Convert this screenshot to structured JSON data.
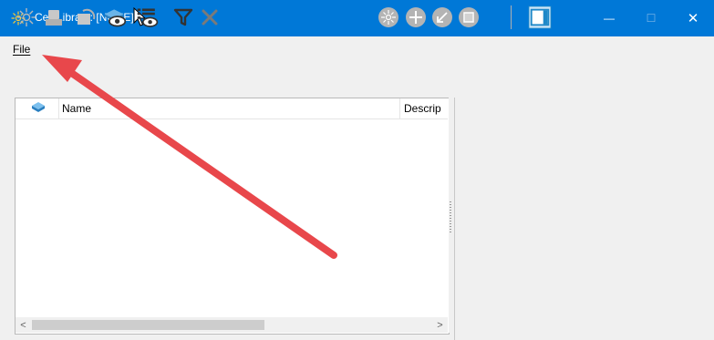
{
  "window": {
    "title": "Cell Library: [NONE]",
    "minimize_glyph": "—",
    "maximize_glyph": "☐",
    "close_glyph": "✕"
  },
  "menu": {
    "items": [
      {
        "label": "File"
      }
    ]
  },
  "toolbar": {
    "left_icons": [
      "cell-sparkle-icon",
      "place-cell-icon",
      "replace-cell-icon",
      "show-preview-icon",
      "list-view-icon",
      "filter-icon",
      "delete-icon"
    ],
    "right_icons": [
      "active-cell-icon",
      "point-cell-icon",
      "terminator-cell-icon",
      "pattern-cell-icon",
      "preview-panel-toggle-icon"
    ]
  },
  "list": {
    "columns": [
      "Name",
      "Descrip"
    ],
    "rows": []
  },
  "scrollbar": {
    "left_glyph": "<",
    "right_glyph": ">"
  },
  "colors": {
    "titlebar": "#0078d7",
    "chrome": "#f0f0f0",
    "annotation_arrow": "#e8474b",
    "toolbar_accent": "#1e88c8"
  }
}
